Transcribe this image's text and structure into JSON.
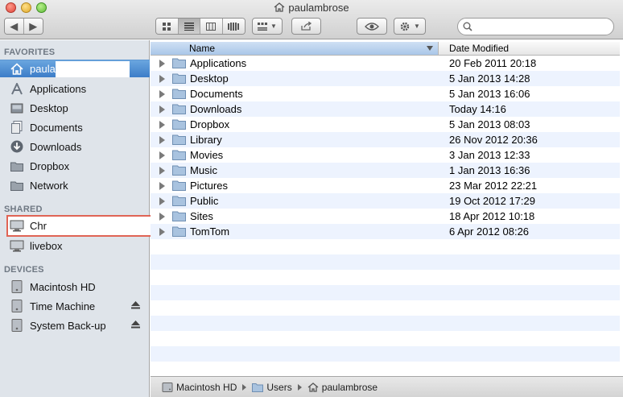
{
  "window": {
    "title": "paulambrose"
  },
  "toolbar": {
    "view_modes": [
      "icon-view",
      "list-view",
      "column-view",
      "coverflow-view"
    ],
    "active_view": "list-view",
    "search": {
      "value": "",
      "placeholder": ""
    }
  },
  "sidebar": {
    "favorites_header": "FAVORITES",
    "favorites": [
      {
        "label": "paula",
        "icon": "home-icon",
        "selected": true
      },
      {
        "label": "Applications",
        "icon": "applications-icon"
      },
      {
        "label": "Desktop",
        "icon": "desktop-icon"
      },
      {
        "label": "Documents",
        "icon": "documents-icon"
      },
      {
        "label": "Downloads",
        "icon": "downloads-icon"
      },
      {
        "label": "Dropbox",
        "icon": "folder-icon"
      },
      {
        "label": "Network",
        "icon": "network-icon"
      }
    ],
    "shared_header": "SHARED",
    "shared": [
      {
        "label": "Chr",
        "icon": "computer-icon"
      },
      {
        "label": "livebox",
        "icon": "computer-icon"
      }
    ],
    "devices_header": "DEVICES",
    "devices": [
      {
        "label": "Macintosh HD",
        "icon": "harddisk-icon"
      },
      {
        "label": "Time Machine",
        "icon": "harddisk-icon",
        "eject": true
      },
      {
        "label": "System Back-up",
        "icon": "harddisk-icon",
        "eject": true
      }
    ]
  },
  "list": {
    "columns": {
      "name": "Name",
      "date": "Date Modified"
    },
    "rows": [
      {
        "name": "Applications",
        "date": "20 Feb 2011 20:18"
      },
      {
        "name": "Desktop",
        "date": "5 Jan 2013 14:28"
      },
      {
        "name": "Documents",
        "date": "5 Jan 2013 16:06"
      },
      {
        "name": "Downloads",
        "date": "Today 14:16"
      },
      {
        "name": "Dropbox",
        "date": "5 Jan 2013 08:03"
      },
      {
        "name": "Library",
        "date": "26 Nov 2012 20:36"
      },
      {
        "name": "Movies",
        "date": "3 Jan 2013 12:33"
      },
      {
        "name": "Music",
        "date": "1 Jan 2013 16:36"
      },
      {
        "name": "Pictures",
        "date": "23 Mar 2012 22:21"
      },
      {
        "name": "Public",
        "date": "19 Oct 2012 17:29"
      },
      {
        "name": "Sites",
        "date": "18 Apr 2012 10:18"
      },
      {
        "name": "TomTom",
        "date": "6 Apr 2012 08:26"
      }
    ]
  },
  "pathbar": {
    "segments": [
      {
        "label": "Macintosh HD",
        "icon": "harddisk-icon"
      },
      {
        "label": "Users",
        "icon": "folder-icon"
      },
      {
        "label": "paulambrose",
        "icon": "home-icon"
      }
    ]
  },
  "colors": {
    "selection": "#3d7dc8",
    "sidebar_bg": "#dfe4ea",
    "stripe": "#edf3fe",
    "highlight_box": "#e06455"
  }
}
